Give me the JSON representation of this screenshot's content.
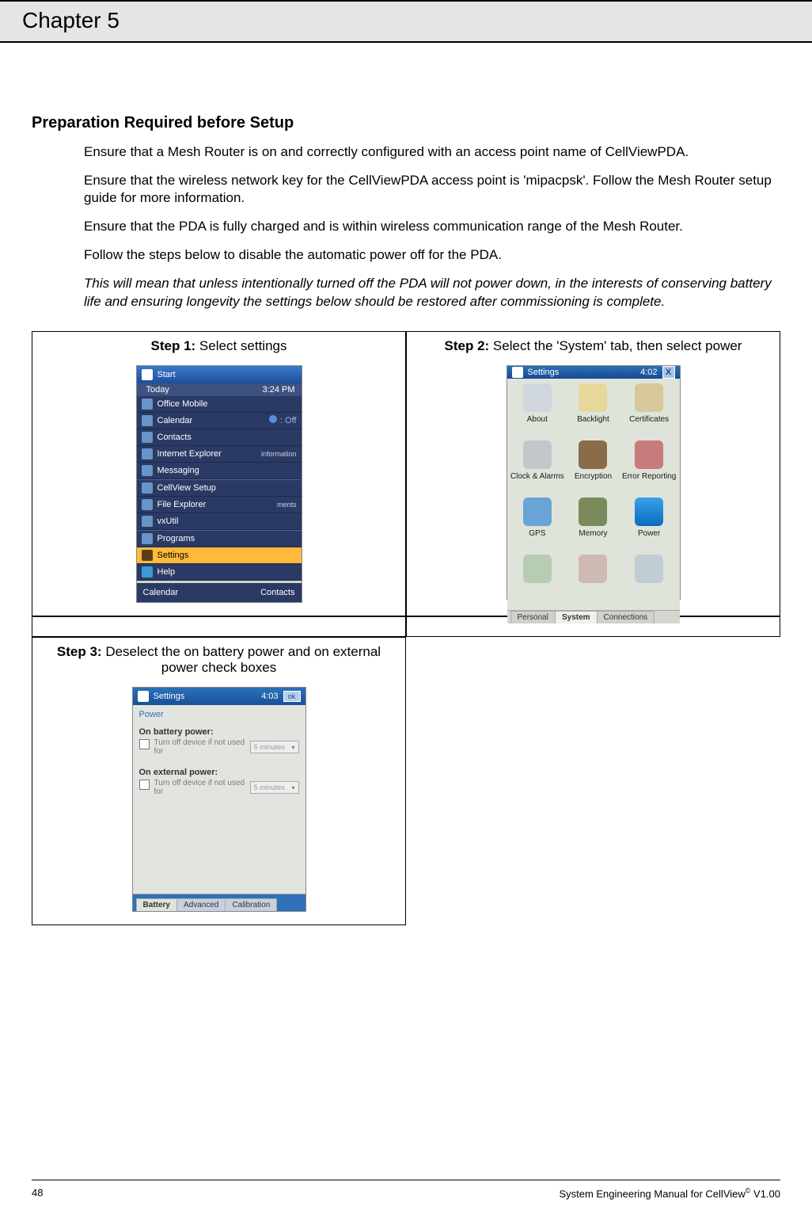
{
  "chapter": "Chapter 5",
  "section_title": "Preparation Required before Setup",
  "paragraphs": {
    "p1": "Ensure that a Mesh Router is on and correctly configured with an access point name of CellViewPDA.",
    "p2": "Ensure that the wireless network key for the CellViewPDA access point is 'mipacpsk'. Follow the Mesh Router setup guide for more information.",
    "p3": "Ensure that the PDA is fully charged and is within wireless communication range of the Mesh Router.",
    "p4": "Follow the steps below to disable the automatic power off for the PDA.",
    "p5": "This will mean that unless intentionally turned off the PDA will not power down, in the interests of conserving battery life and ensuring longevity the settings below should be restored after commissioning is complete."
  },
  "steps": {
    "s1": {
      "prefix": "Step 1:",
      "text": " Select settings"
    },
    "s2": {
      "prefix": "Step 2:",
      "text": " Select the 'System' tab, then select power"
    },
    "s3": {
      "prefix": "Step 3:",
      "text": " Deselect the on battery power and on external power check boxes"
    }
  },
  "shot1": {
    "title": "Start",
    "time": "3:24 PM",
    "today_label": "Today",
    "bt_label": ": Off",
    "info_hint": "information",
    "hints_low": "ments",
    "menu": {
      "m1": "Office Mobile",
      "m2": "Calendar",
      "m3": "Contacts",
      "m4": "Internet Explorer",
      "m5": "Messaging",
      "m6": "CellView Setup",
      "m7": "File Explorer",
      "m8": "vxUtil",
      "m9": "Programs",
      "m10": "Settings",
      "m11": "Help"
    },
    "bottom_left": "Calendar",
    "bottom_right": "Contacts"
  },
  "shot2": {
    "title": "Settings",
    "clock": "4:02",
    "close": "X",
    "apps": {
      "a1": "About",
      "a2": "Backlight",
      "a3": "Certificates",
      "a4": "Clock & Alarms",
      "a5": "Encryption",
      "a6": "Error Reporting",
      "a7": "GPS",
      "a8": "Memory",
      "a9": "Power"
    },
    "tabs": {
      "t1": "Personal",
      "t2": "System",
      "t3": "Connections"
    }
  },
  "shot3": {
    "title": "Settings",
    "clock": "4:03",
    "ok": "ok",
    "header": "Power",
    "g1_label": "On battery power:",
    "g1_text": "Turn off device if not used for",
    "g1_sel": "5 minutes",
    "g2_label": "On external power:",
    "g2_text": "Turn off device if not used for",
    "g2_sel": "5 minutes",
    "tabs": {
      "t1": "Battery",
      "t2": "Advanced",
      "t3": "Calibration"
    }
  },
  "footer": {
    "page": "48",
    "right_pre": "System Engineering Manual for CellView",
    "right_sup": "©",
    "right_post": " V1.00"
  }
}
